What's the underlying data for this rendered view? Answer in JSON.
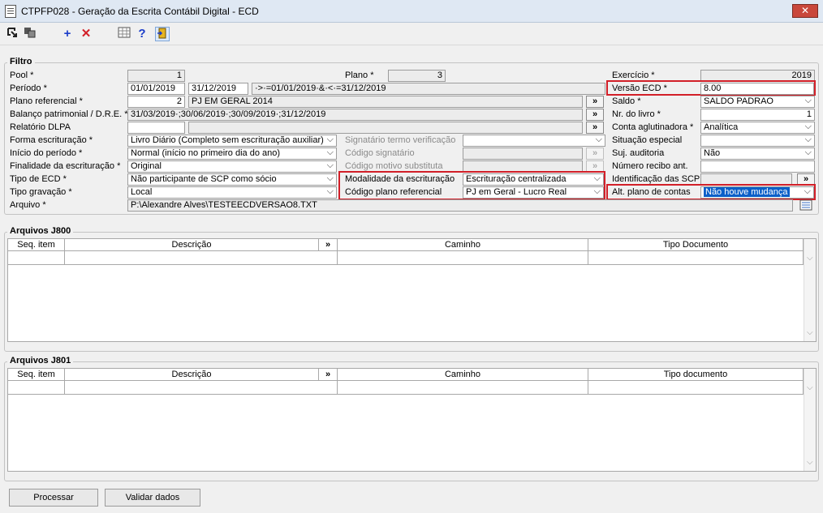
{
  "window": {
    "title": "CTPFP028 - Geração da Escrita Contábil Digital - ECD",
    "close": "✕"
  },
  "toolbar": {
    "add": "+",
    "delete": "✕",
    "help": "?"
  },
  "filtro": {
    "legend": "Filtro",
    "pool": {
      "label": "Pool *",
      "value": "1"
    },
    "plano": {
      "label": "Plano *",
      "value": "3"
    },
    "exercicio": {
      "label": "Exercício *",
      "value": "2019"
    },
    "periodo": {
      "label": "Período *",
      "start": "01/01/2019",
      "end": "31/12/2019",
      "expr": "·>·=01/01/2019·&·<·=31/12/2019"
    },
    "versao_ecd": {
      "label": "Versão ECD *",
      "value": "8.00"
    },
    "plano_referencial": {
      "label": "Plano referencial *",
      "code": "2",
      "desc": "PJ EM GERAL 2014",
      "button": "»"
    },
    "saldo": {
      "label": "Saldo *",
      "value": "SALDO PADRAO"
    },
    "balanco": {
      "label": "Balanço patrimonial / D.R.E. *",
      "value": "31/03/2019·;30/06/2019·;30/09/2019·;31/12/2019",
      "button": "»"
    },
    "nr_livro": {
      "label": "Nr. do livro *",
      "value": "1"
    },
    "relatorio_dlpa": {
      "label": "Relatório DLPA",
      "button": "»"
    },
    "conta_aglutinadora": {
      "label": "Conta aglutinadora *",
      "value": "Analítica"
    },
    "forma_escrituracao": {
      "label": "Forma escrituração *",
      "value": "Livro Diário (Completo sem escrituração auxiliar)"
    },
    "signatario_termo": {
      "label": "Signatário termo verificação"
    },
    "situacao_especial": {
      "label": "Situação especial"
    },
    "inicio_periodo": {
      "label": "Início do período *",
      "value": "Normal (início no primeiro dia do ano)"
    },
    "codigo_signatario": {
      "label": "Código signatário"
    },
    "suj_auditoria": {
      "label": "Suj. auditoria",
      "value": "Não"
    },
    "finalidade": {
      "label": "Finalidade da escrituração *",
      "value": "Original"
    },
    "codigo_motivo": {
      "label": "Código motivo substituta"
    },
    "numero_recibo": {
      "label": "Número recibo ant."
    },
    "tipo_ecd": {
      "label": "Tipo de ECD *",
      "value": "Não participante de SCP como sócio"
    },
    "modalidade": {
      "label": "Modalidade da escrituração",
      "value": "Escrituração centralizada"
    },
    "identificacao_scp": {
      "label": "Identificação das SCP",
      "button": "»"
    },
    "tipo_gravacao": {
      "label": "Tipo gravação *",
      "value": "Local"
    },
    "codigo_plano_ref": {
      "label": "Código plano referencial",
      "value": "PJ em Geral - Lucro Real"
    },
    "alt_plano_contas": {
      "label": "Alt. plano de contas",
      "value": "Não houve mudança"
    },
    "arquivo": {
      "label": "Arquivo *",
      "value": "P:\\Alexandre Alves\\TESTEECDVERSAO8.TXT"
    }
  },
  "j800": {
    "legend": "Arquivos J800",
    "columns": [
      "Seq. item",
      "Descrição",
      "»",
      "Caminho",
      "Tipo Documento"
    ]
  },
  "j801": {
    "legend": "Arquivos J801",
    "columns": [
      "Seq. item",
      "Descrição",
      "»",
      "Caminho",
      "Tipo documento"
    ]
  },
  "actions": {
    "processar": "Processar",
    "validar": "Validar dados"
  }
}
